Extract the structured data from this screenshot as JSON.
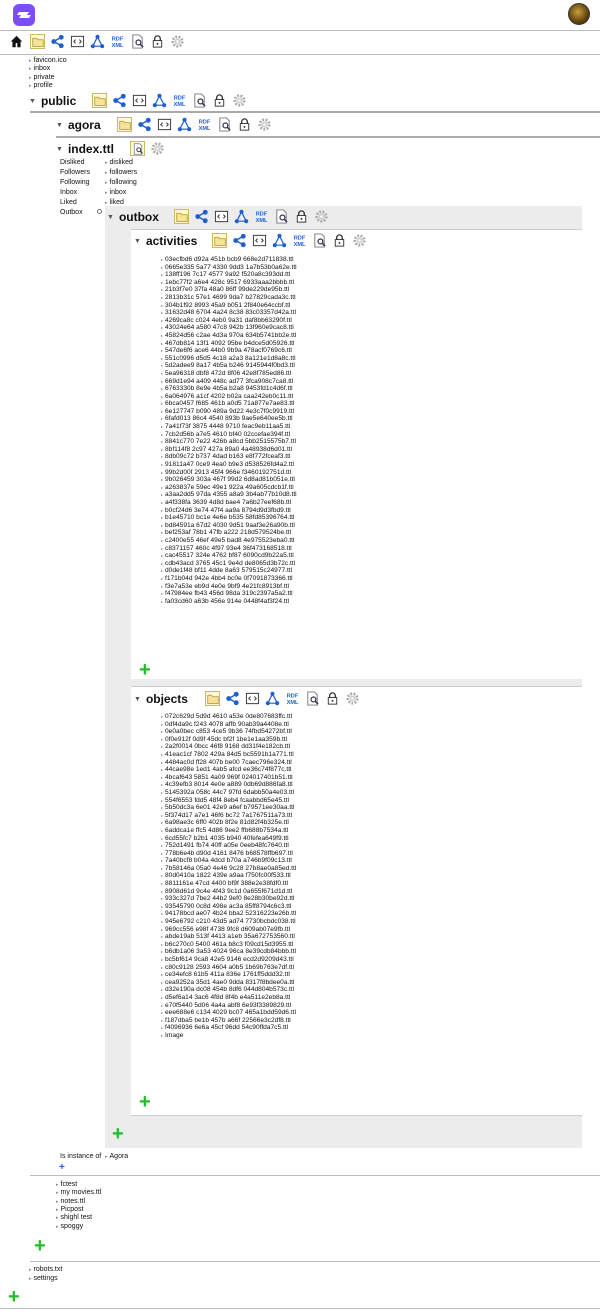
{
  "logo": "solid-logo-icon",
  "top_links": [
    "favicon.ico",
    "inbox",
    "private",
    "profile"
  ],
  "public": {
    "title": "public"
  },
  "agora": {
    "title": "agora"
  },
  "index": {
    "title": "index.ttl",
    "props": [
      {
        "key": "Disliked",
        "val": "disliked"
      },
      {
        "key": "Followers",
        "val": "followers"
      },
      {
        "key": "Following",
        "val": "following"
      },
      {
        "key": "Inbox",
        "val": "inbox"
      },
      {
        "key": "Liked",
        "val": "liked"
      },
      {
        "key": "Outbox",
        "val": ""
      }
    ]
  },
  "outbox": {
    "title": "outbox"
  },
  "activities": {
    "title": "activities",
    "files": [
      "03ecfbd6 d92a 451b bcb9 668e2d711838.ttl",
      "0665e335 5a77 4330 9dd3 1a7b53b0a62e.ttl",
      "138ff196 7c17 4577 9a92 f520a8c393dd.ttl",
      "1ebc77f2 a6e4 428c 9517 6933aaa2bbbb.ttl",
      "21b3f7e0 37fa 48a0 86ff 99de229de95b.ttl",
      "2813b31c 57e1 4699 9da7 b27829cada3c.ttl",
      "304b1f92 8993 45a9 b051 2f840e64ccbf.ttl",
      "31632d48 6704 4a24 8c38 83c03357d42a.ttl",
      "4269ca8c c024 4eb0 9a31 daf8bb63290f.ttl",
      "43024e64 a580 47c8 942b 13f960e9cac8.ttl",
      "45824d56 c2ae 4d3a 970a 634b5741bb2e.ttl",
      "467db814 13f1 4092 95be b4dce5d05926.ttl",
      "547de6f6 ace6 44b0 9b9a 478acf0769c6.ttl",
      "551c0996 d5d5 4c18 a2a3 8a121e1d8a8c.ttl",
      "5d2adee9 8a17 4b5a b246 9145944f0bd3.ttl",
      "5ea96318 dbf8 472d 8f06 42e8f785ed86.ttl",
      "669d1e94 a409 448c ad77 3fca908c7ca8.ttl",
      "6763330b 8e9e 4b5a b2a8 9453fd1c4d6f.ttl",
      "6a064976 a1cf 4202 b02a caa242eb0c11.ttl",
      "6bca0457 f685 461b a0d5 71a877e7ae83.ttl",
      "6e127747 b090 489a 9d22 4e3c7f0c9919.ttl",
      "6fafd013 86c4 4540 893b 9ae5e640ee5b.ttl",
      "7a41f73f 3875 4448 9710 feac9eb11aa5.ttl",
      "7cb2d56b a7e5 4610 bf40 02ccefae394f.ttl",
      "8841c770 7e22 426b a8cd 5bb2515575b7.ttl",
      "8bf114f8 2c97 427a 89a0 4a48938d6d01.ttl",
      "8db09c72 b737 4dad b163 e8f772fceaf3.ttl",
      "91811a47 0ce9 4ea0 b9e3 d538526fd4a2.ttl",
      "99b2d00f 2913 45f4 966e f3460192751d.ttl",
      "9b026459 303a 467f 99d2 6d8ad81b051e.ttl",
      "a263837e 59ec 49e1 922a 49a605cdcb1f.ttl",
      "a3aa2dd5 97da 4355 a8a9 3b4ab77b10d8.ttl",
      "a4f338fa 3639 4d8d bae4 7a6b27eef68b.ttl",
      "b0cf24d6 3e74 47f4 aa9a 8794d9d3fbd9.ttl",
      "b1e45710 bc1e 4e6e b535 58fd85396764.ttl",
      "bd84591a 67d2 4030 9d51 9aaf3e26a90b.ttl",
      "bef253af 78b1 47fb a222 218d579524be.ttl",
      "c2400e55 46ef 49e5 bad8 4e975523eba0.ttl",
      "c8371157 460c 4f97 93e4 36f473168518.ttl",
      "cac45517 324e 4762 bf87 6090cd9b22a5.ttl",
      "cdb43acd 3765 45c1 9e4d de8065d3b72c.ttl",
      "d0de1f48 bf11 4dde 8a63 579515c24977.ttl",
      "f171b04d 942e 4bb4 bc0e 0f7091873366.ttl",
      "f3e7a53e eb9d 4e0e 9bf9 4e21fc8913bf.ttl",
      "f47984ee fb43 456d 98da 319c2397a5a2.ttl",
      "fa03cd60 a63b 456e 914e 0448f4af3f24.ttl"
    ]
  },
  "objects": {
    "title": "objects",
    "files": [
      "072c629d 5d9d 4610 a53e 0de807683ffc.ttl",
      "0df4da9c f243 4078 affb 90ab39a4408e.ttl",
      "0e0a0bec c853 4ce5 9b36 74fbd54272bf.ttl",
      "0f0e912f 0d9f 45dc bf2f 1be1e1aa359b.ttl",
      "2a2f0014 0bcc 46f8 9168 dd31f4e182cb.ttl",
      "41eac1cf 7802 429a 84d5 bc5591b1a771.ttl",
      "4484ac0d ff28 407b be00 7caec796e324.ttl",
      "44cae98e 1ed1 4ab5 afcd ee36c74f877c.ttl",
      "4bcaf643 5851 4a09 969f 024017401b51.ttl",
      "4c39efb3 8014 4e0e a889 0db69d886fa8.ttl",
      "5145392a 058c 44c7 97fd 6dabb50a4e03.ttl",
      "554f6553 fdd5 48f4 8eb4 fcaabbd65e45.ttl",
      "5b50dc3a 6e01 42e9 a6ef b79571ee30aa.ttl",
      "5f374d17 a7e1 46f6 bc72 7a1767511a73.ttl",
      "6a98ae3c 6ff0 402b 8f2e 81d82f4b325e.ttl",
      "6addca1e ffc5 4d86 9ee2 ffb688b7534a.ttl",
      "6cd55fc7 b2b1 4035 b940 40fefea649f9.ttl",
      "752d1491 fb74 40ff a05e 0eeb48fc7640.ttl",
      "778b6e4b d90d 4161 8476 b68578ffb697.ttl",
      "7a40bcf8 b04a 4dcd b70a a746b9f09c13.ttl",
      "7b58146a 05a0 4e46 9c28 27b8ae0a85ed.ttl",
      "80d0410a 1822 439e a9aa f750fc00f533.ttl",
      "8811161e 47cd 4400 bf9f 388e2e38fdf0.ttl",
      "8908d61d 9c4e 4f43 9c1d 0a655f671d1d.ttl",
      "933c327d 7be2 44b2 9ef0 8e28b30be92d.ttl",
      "93545790 0c8d 498e ac3a 85ff8794c6c3.ttl",
      "94178bcd ae07 4b24 bba2 52316223e26b.ttl",
      "945e6792 c210 43d5 ad74 7730bcbdc038.ttl",
      "969cc556 e98f 4738 9fc8 d609ab07e9fb.ttl",
      "abde19ab 513f 4413 a1eb 35a672753560.ttl",
      "b6c270c0 5400 461a b8c3 f09cd15d3955.ttl",
      "b6db1a06 3a53 4024 96ca 8e39cdb84bbb.ttl",
      "bc5bf614 9ca8 42e5 9146 ecd2d9209d43.ttl",
      "c80c9128 2593 4604 a0b5 1b69b763e7df.ttl",
      "ce34efc8 61b5 411a 836e 1761ff5ddd32.ttl",
      "cea9252a 35d1 4ae0 9dda 8317f8bdee0a.ttl",
      "d32e190a dc08 454b 8df6 044d804b573c.ttl",
      "d5ef6a14 3ac6 4f8d 8f4b e4a511e2eb8a.ttl",
      "e70f5440 5d06 4a4a abf8 6e93f3389829.ttl",
      "eee688e6 c134 4029 bc07 465a1bdd59d6.ttl",
      "f187dba5 be1b 457b a66f 22566e3c2df8.ttl",
      "f4096936 6e6a 45cf 96dd 54c90ffda7c5.ttl",
      "Image"
    ]
  },
  "instance": {
    "label": "Is instance of",
    "value": "Agora"
  },
  "public_files": [
    "fctest",
    "my movies.ttl",
    "notes.ttl",
    "Picpost",
    "shighl test",
    "spoggy"
  ],
  "bottom_links": [
    "robots.txt",
    "settings"
  ],
  "colors": {
    "accent": "#7c4dff",
    "plus": "#1fbd2a",
    "icon_blue": "#1f5fd1"
  }
}
